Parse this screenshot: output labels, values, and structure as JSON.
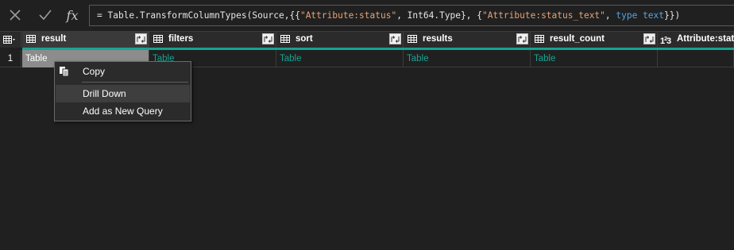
{
  "formula_bar": {
    "cancel_icon": "close-icon",
    "confirm_icon": "checkmark-icon",
    "fx_label": "fx",
    "formula_parts": [
      {
        "text": "= Table.TransformColumnTypes(Source,{{",
        "cls": ""
      },
      {
        "text": "\"Attribute:status\"",
        "cls": "str"
      },
      {
        "text": ", Int64.Type}, {",
        "cls": ""
      },
      {
        "text": "\"Attribute:status_text\"",
        "cls": "str"
      },
      {
        "text": ", ",
        "cls": ""
      },
      {
        "text": "type text",
        "cls": "kw"
      },
      {
        "text": "}})",
        "cls": ""
      }
    ]
  },
  "columns": [
    {
      "name": "result",
      "type_icon": "table-icon",
      "has_expand": true
    },
    {
      "name": "filters",
      "type_icon": "table-icon",
      "has_expand": true
    },
    {
      "name": "sort",
      "type_icon": "table-icon",
      "has_expand": true
    },
    {
      "name": "results",
      "type_icon": "table-icon",
      "has_expand": true
    },
    {
      "name": "result_count",
      "type_icon": "table-icon",
      "has_expand": true
    },
    {
      "name": "Attribute:status",
      "type_icon": "whole-number-icon",
      "has_expand": false
    }
  ],
  "rows": [
    {
      "num": "1",
      "cells": [
        "Table",
        "Table",
        "Table",
        "Table",
        "Table",
        ""
      ]
    }
  ],
  "context_menu": {
    "items": [
      "Copy",
      "Drill Down",
      "Add as New Query"
    ],
    "copy_icon": "copy-icon"
  },
  "type_icon_labels": {
    "whole_number": "123"
  },
  "colors": {
    "accent": "#17a392",
    "background": "#202020",
    "header": "#2b2b2b"
  }
}
